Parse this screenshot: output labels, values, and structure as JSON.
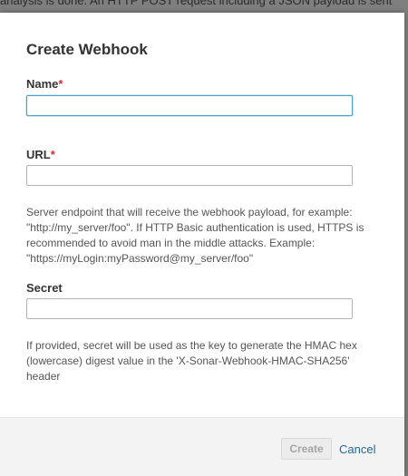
{
  "background": {
    "partial_text": "analysis is done. An HTTP POST request including a JSON payload is sent"
  },
  "modal": {
    "title": "Create Webhook",
    "fields": {
      "name": {
        "label": "Name",
        "required_mark": "*",
        "value": "",
        "placeholder": ""
      },
      "url": {
        "label": "URL",
        "required_mark": "*",
        "value": "",
        "placeholder": "",
        "help": "Server endpoint that will receive the webhook payload, for example: \"http://my_server/foo\". If HTTP Basic authentication is used, HTTPS is recommended to avoid man in the middle attacks. Example: \"https://myLogin:myPassword@my_server/foo\""
      },
      "secret": {
        "label": "Secret",
        "value": "",
        "placeholder": "",
        "help": "If provided, secret will be used as the key to generate the HMAC hex (lowercase) digest value in the 'X-Sonar-Webhook-HMAC-SHA256' header"
      }
    },
    "footer": {
      "create_label": "Create",
      "cancel_label": "Cancel"
    }
  },
  "colors": {
    "required": "#d02f3a",
    "link": "#236a97",
    "focus_border": "#4b9fd5",
    "overlay": "#7f7f7f"
  }
}
